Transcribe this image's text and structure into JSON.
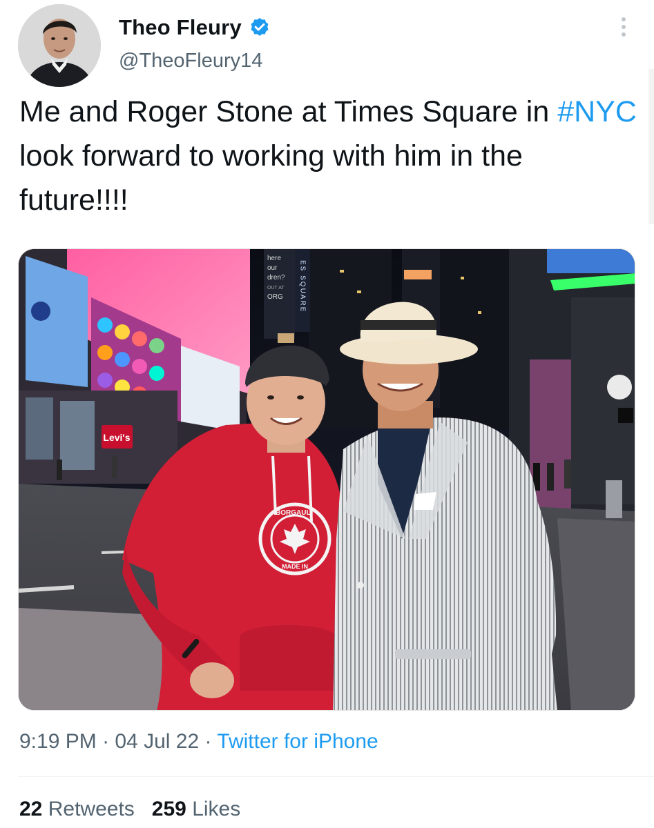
{
  "author": {
    "name": "Theo Fleury",
    "handle": "@TheoFleury14",
    "verified": true
  },
  "tweet": {
    "text_part1": "Me and Roger Stone at Times Square in ",
    "hashtag": "#NYC",
    "text_part2": " look forward to working with him in the future!!!!"
  },
  "meta": {
    "time": "9:19 PM",
    "separator": " · ",
    "date": "04 Jul 22",
    "source": "Twitter for iPhone"
  },
  "stats": {
    "retweets_count": "22",
    "retweets_label": "Retweets",
    "likes_count": "259",
    "likes_label": "Likes"
  },
  "photo_signage": {
    "levis": "Levi's",
    "sign_lines": [
      "here",
      "our",
      "dren?",
      "OUT AT",
      "ORG"
    ],
    "vertical_sign": "ES SQUARE",
    "hoodie_top": "BORGAULT",
    "hoodie_bottom": "MADE IN"
  },
  "colors": {
    "accent": "#1d9bf0",
    "secondary_text": "#536471",
    "primary_text": "#0f1419"
  },
  "icons": {
    "verified": "verified-badge-icon",
    "more": "more-options-icon"
  }
}
